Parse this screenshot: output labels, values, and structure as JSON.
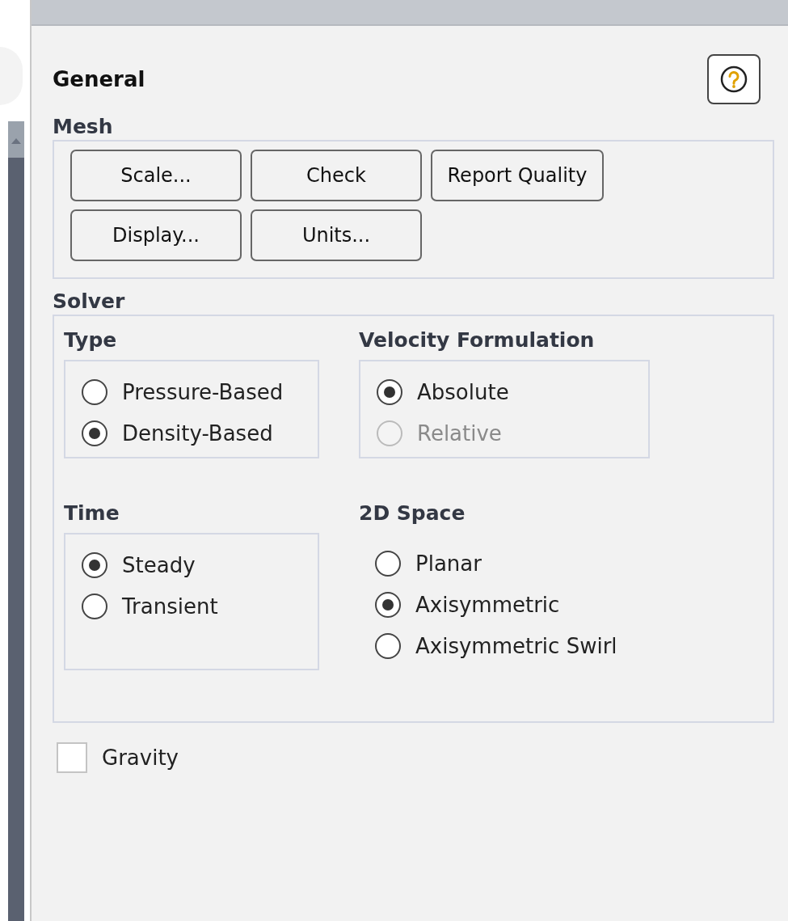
{
  "panel": {
    "title": "General"
  },
  "mesh": {
    "label": "Mesh",
    "buttons": [
      {
        "label": "Scale..."
      },
      {
        "label": "Check"
      },
      {
        "label": "Report Quality"
      },
      {
        "label": "Display..."
      },
      {
        "label": "Units..."
      }
    ]
  },
  "solver": {
    "label": "Solver",
    "groups": [
      {
        "label": "Type",
        "boxed": true,
        "options": [
          {
            "label": "Pressure-Based",
            "selected": false,
            "disabled": false
          },
          {
            "label": "Density-Based",
            "selected": true,
            "disabled": false
          }
        ]
      },
      {
        "label": "Velocity Formulation",
        "boxed": true,
        "options": [
          {
            "label": "Absolute",
            "selected": true,
            "disabled": false
          },
          {
            "label": "Relative",
            "selected": false,
            "disabled": true
          }
        ]
      },
      {
        "label": "Time",
        "boxed": true,
        "options": [
          {
            "label": "Steady",
            "selected": true,
            "disabled": false
          },
          {
            "label": "Transient",
            "selected": false,
            "disabled": false
          }
        ]
      },
      {
        "label": "2D Space",
        "boxed": false,
        "options": [
          {
            "label": "Planar",
            "selected": false,
            "disabled": false
          },
          {
            "label": "Axisymmetric",
            "selected": true,
            "disabled": false
          },
          {
            "label": "Axisymmetric Swirl",
            "selected": false,
            "disabled": false
          }
        ]
      }
    ]
  },
  "gravity": {
    "label": "Gravity",
    "checked": false
  }
}
